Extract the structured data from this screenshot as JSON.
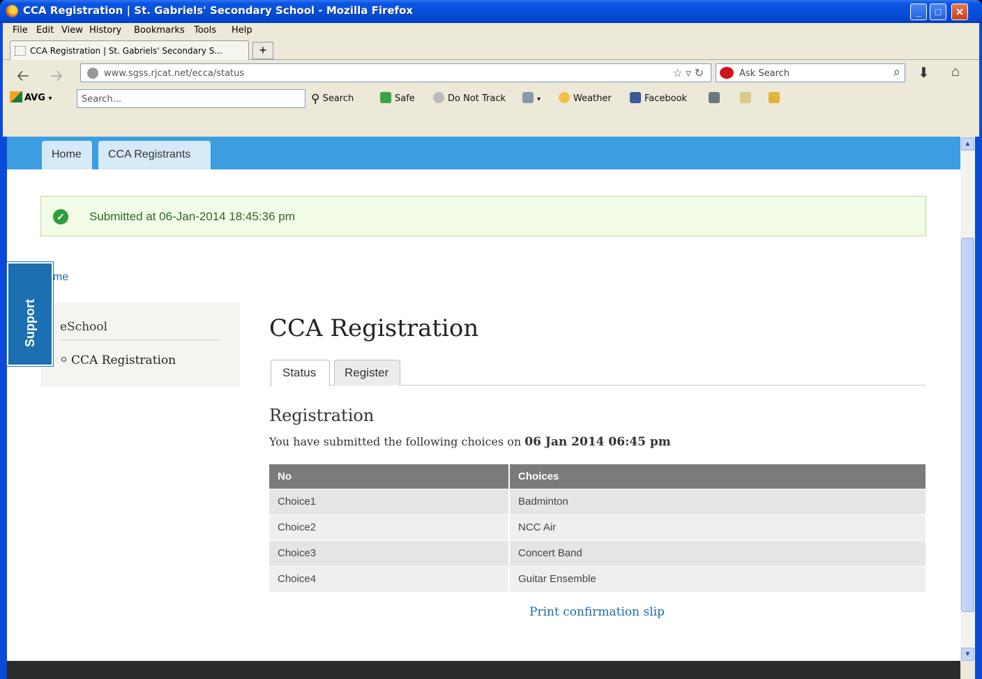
{
  "window": {
    "title": "CCA Registration | St. Gabriels' Secondary School - Mozilla Firefox",
    "minimize": "_",
    "maximize": "□",
    "close": "✕"
  },
  "menu": [
    "File",
    "Edit",
    "View",
    "History",
    "Bookmarks",
    "Tools",
    "Help"
  ],
  "browser_tab": {
    "title": "CCA Registration | St. Gabriels' Secondary S...",
    "new_tab": "+"
  },
  "navbar": {
    "url": "www.sgss.rjcat.net/ecca/status",
    "ask_placeholder": "Ask Search"
  },
  "avg_toolbar": {
    "brand": "AVG",
    "search_placeholder": "Search...",
    "search_label": "Search",
    "safe_label": "Safe",
    "dnt_label": "Do Not Track",
    "weather_label": "Weather",
    "facebook_label": "Facebook"
  },
  "site_nav": {
    "tabs": [
      "Home",
      "CCA Registrants"
    ]
  },
  "alert": {
    "message": "Submitted at 06-Jan-2014 18:45:36 pm"
  },
  "breadcrumb": "ome",
  "support_label": "Support",
  "sidebar": {
    "title": "eSchool",
    "item": "CCA Registration"
  },
  "main": {
    "heading": "CCA Registration",
    "tabs": [
      "Status",
      "Register"
    ],
    "section_title": "Registration",
    "lead": "You have submitted the following choices on ",
    "lead_date": "06 Jan 2014 06:45 pm",
    "table": {
      "headers": [
        "No",
        "Choices"
      ],
      "rows": [
        [
          "Choice1",
          "Badminton"
        ],
        [
          "Choice2",
          "NCC Air"
        ],
        [
          "Choice3",
          "Concert Band"
        ],
        [
          "Choice4",
          "Guitar Ensemble"
        ]
      ]
    },
    "print_link": "Print confirmation slip"
  },
  "colors": {
    "nav_blue": "#3c9de0",
    "success_green": "#2c9d3b",
    "link_blue": "#1b6bab",
    "support_blue": "#1c6fb0"
  }
}
